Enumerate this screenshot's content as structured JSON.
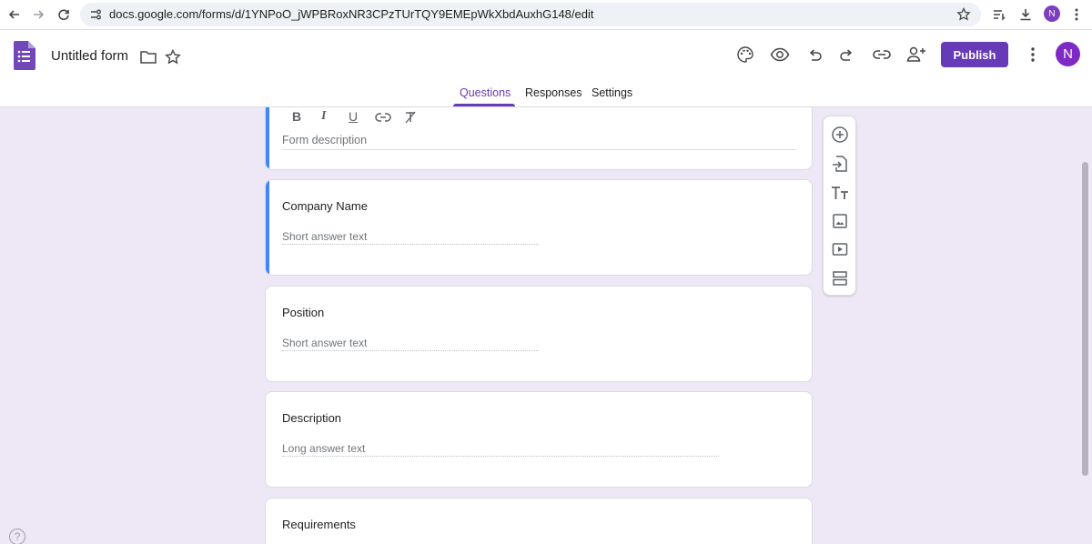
{
  "browser": {
    "url": "docs.google.com/forms/d/1YNPoO_jWPBRoxNR3CPzTUrTQY9EMEpWkXbdAuxhG148/edit",
    "profile_initial": "N"
  },
  "header": {
    "title": "Untitled form",
    "publish_label": "Publish",
    "avatar_initial": "N",
    "tabs": [
      {
        "label": "Questions",
        "active": true
      },
      {
        "label": "Responses",
        "active": false
      },
      {
        "label": "Settings",
        "active": false
      }
    ]
  },
  "form": {
    "format_buttons": [
      "B",
      "I",
      "U"
    ],
    "description_placeholder": "Form description",
    "questions": [
      {
        "title": "Company Name",
        "answer_placeholder": "Short answer text",
        "type": "short"
      },
      {
        "title": "Position",
        "answer_placeholder": "Short answer text",
        "type": "short"
      },
      {
        "title": "Description",
        "answer_placeholder": "Long answer text",
        "type": "long"
      },
      {
        "title": "Requirements",
        "answer_placeholder": "",
        "type": "unknown"
      }
    ]
  },
  "toolbar": {
    "icons": [
      "add-question-icon",
      "import-questions-icon",
      "add-title-icon",
      "add-image-icon",
      "add-video-icon",
      "add-section-icon"
    ]
  },
  "colors": {
    "accent": "#673ab7",
    "canvas_bg": "#ede7f6",
    "selected_bar": "#4285f4"
  },
  "help_label": "?"
}
